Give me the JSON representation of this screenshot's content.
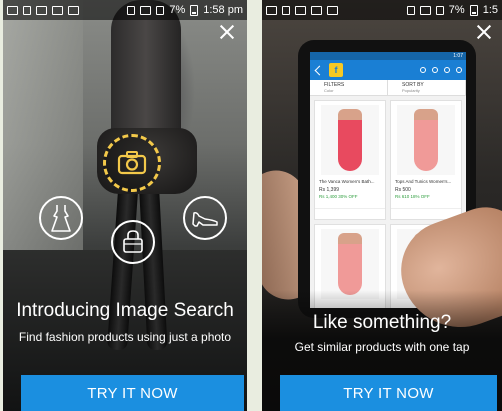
{
  "status_bar": {
    "left_screen": {
      "battery": "7%",
      "time": "1:58 pm"
    },
    "right_screen": {
      "battery": "7%",
      "time": "1:5"
    }
  },
  "left_screen": {
    "title": "Introducing Image Search",
    "subtitle": "Find fashion products using just a photo",
    "cta_label": "TRY IT NOW",
    "icons": [
      "camera-icon",
      "dress-icon",
      "handbag-icon",
      "shoe-icon",
      "close-icon"
    ]
  },
  "right_screen": {
    "title": "Like something?",
    "subtitle": "Get similar products with one tap",
    "cta_label": "TRY IT NOW",
    "phone": {
      "status_time": "1:07",
      "logo": "f",
      "filters_label": "FILTERS",
      "filters_value": "Color",
      "sort_label": "SORT BY",
      "sort_value": "Popularity",
      "products": [
        {
          "name": "The Vanca Women's Bath...",
          "price": "Rs 1,399",
          "mrp": "Rs 1,400 30% OFF",
          "color": "red"
        },
        {
          "name": "Tops And Tunics Women's...",
          "price": "Rs 500",
          "mrp": "Rs 610 18% OFF",
          "color": "pink"
        },
        {
          "name": "",
          "price": "",
          "mrp": "",
          "color": "pink"
        },
        {
          "name": "",
          "price": "",
          "mrp": "",
          "color": "pink"
        }
      ]
    },
    "icons": [
      "visual-search-icon",
      "close-icon"
    ]
  },
  "colors": {
    "accent": "#1b8fe0",
    "camera_ring": "#f3c94a",
    "app_bar": "#1a7fd4",
    "logo_yellow": "#f7c923"
  }
}
